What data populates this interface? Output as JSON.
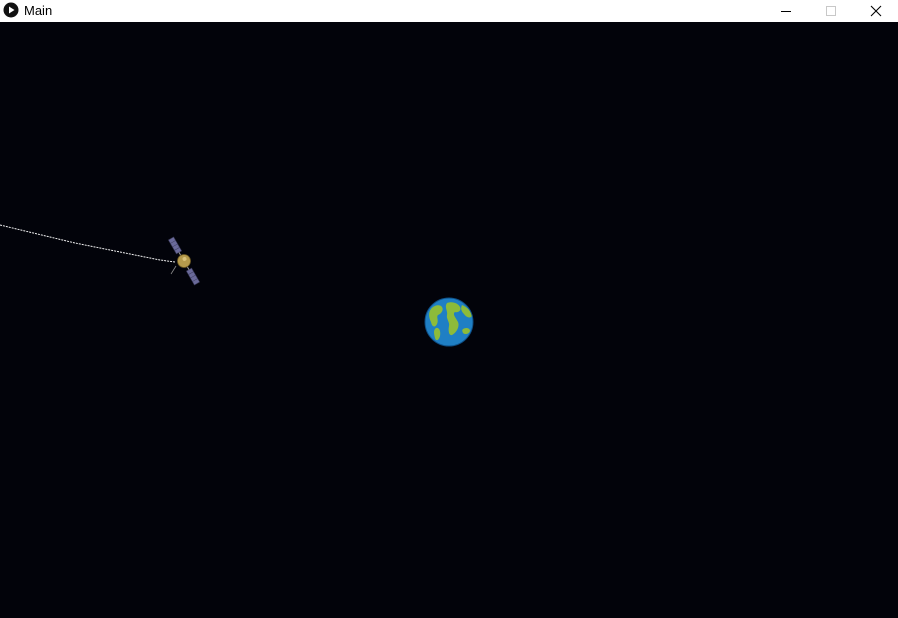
{
  "window": {
    "title": "Main",
    "app_icon": "play-circle-icon",
    "controls": {
      "minimize": "minimize-icon",
      "maximize": "maximize-icon",
      "close": "close-icon"
    }
  },
  "scene": {
    "background_color": "#02030a",
    "earth_icon": "earth-globe-icon",
    "satellite_icon": "satellite-icon",
    "trail_color": "#ffffff",
    "ocean_color": "#1f7fc4",
    "land_color": "#8dbb3a"
  }
}
